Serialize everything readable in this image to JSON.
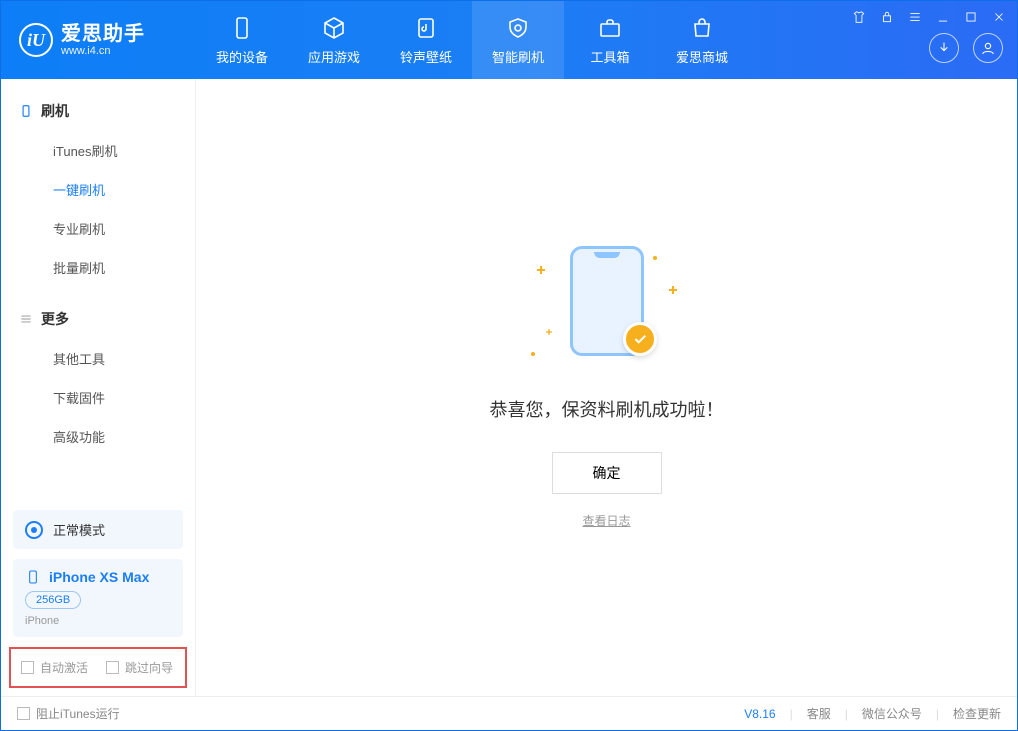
{
  "brand": {
    "name": "爱思助手",
    "url": "www.i4.cn",
    "logo_letter": "iU"
  },
  "tabs": [
    {
      "label": "我的设备"
    },
    {
      "label": "应用游戏"
    },
    {
      "label": "铃声壁纸"
    },
    {
      "label": "智能刷机"
    },
    {
      "label": "工具箱"
    },
    {
      "label": "爱思商城"
    }
  ],
  "sidebar": {
    "group1_title": "刷机",
    "group1_items": [
      "iTunes刷机",
      "一键刷机",
      "专业刷机",
      "批量刷机"
    ],
    "group2_title": "更多",
    "group2_items": [
      "其他工具",
      "下载固件",
      "高级功能"
    ]
  },
  "device": {
    "status": "正常模式",
    "name": "iPhone XS Max",
    "storage": "256GB",
    "type": "iPhone"
  },
  "checks": {
    "auto_activate": "自动激活",
    "skip_guide": "跳过向导"
  },
  "main": {
    "message": "恭喜您，保资料刷机成功啦！",
    "ok": "确定",
    "view_log": "查看日志"
  },
  "footer": {
    "block_itunes": "阻止iTunes运行",
    "version": "V8.16",
    "support": "客服",
    "wechat": "微信公众号",
    "update": "检查更新"
  }
}
